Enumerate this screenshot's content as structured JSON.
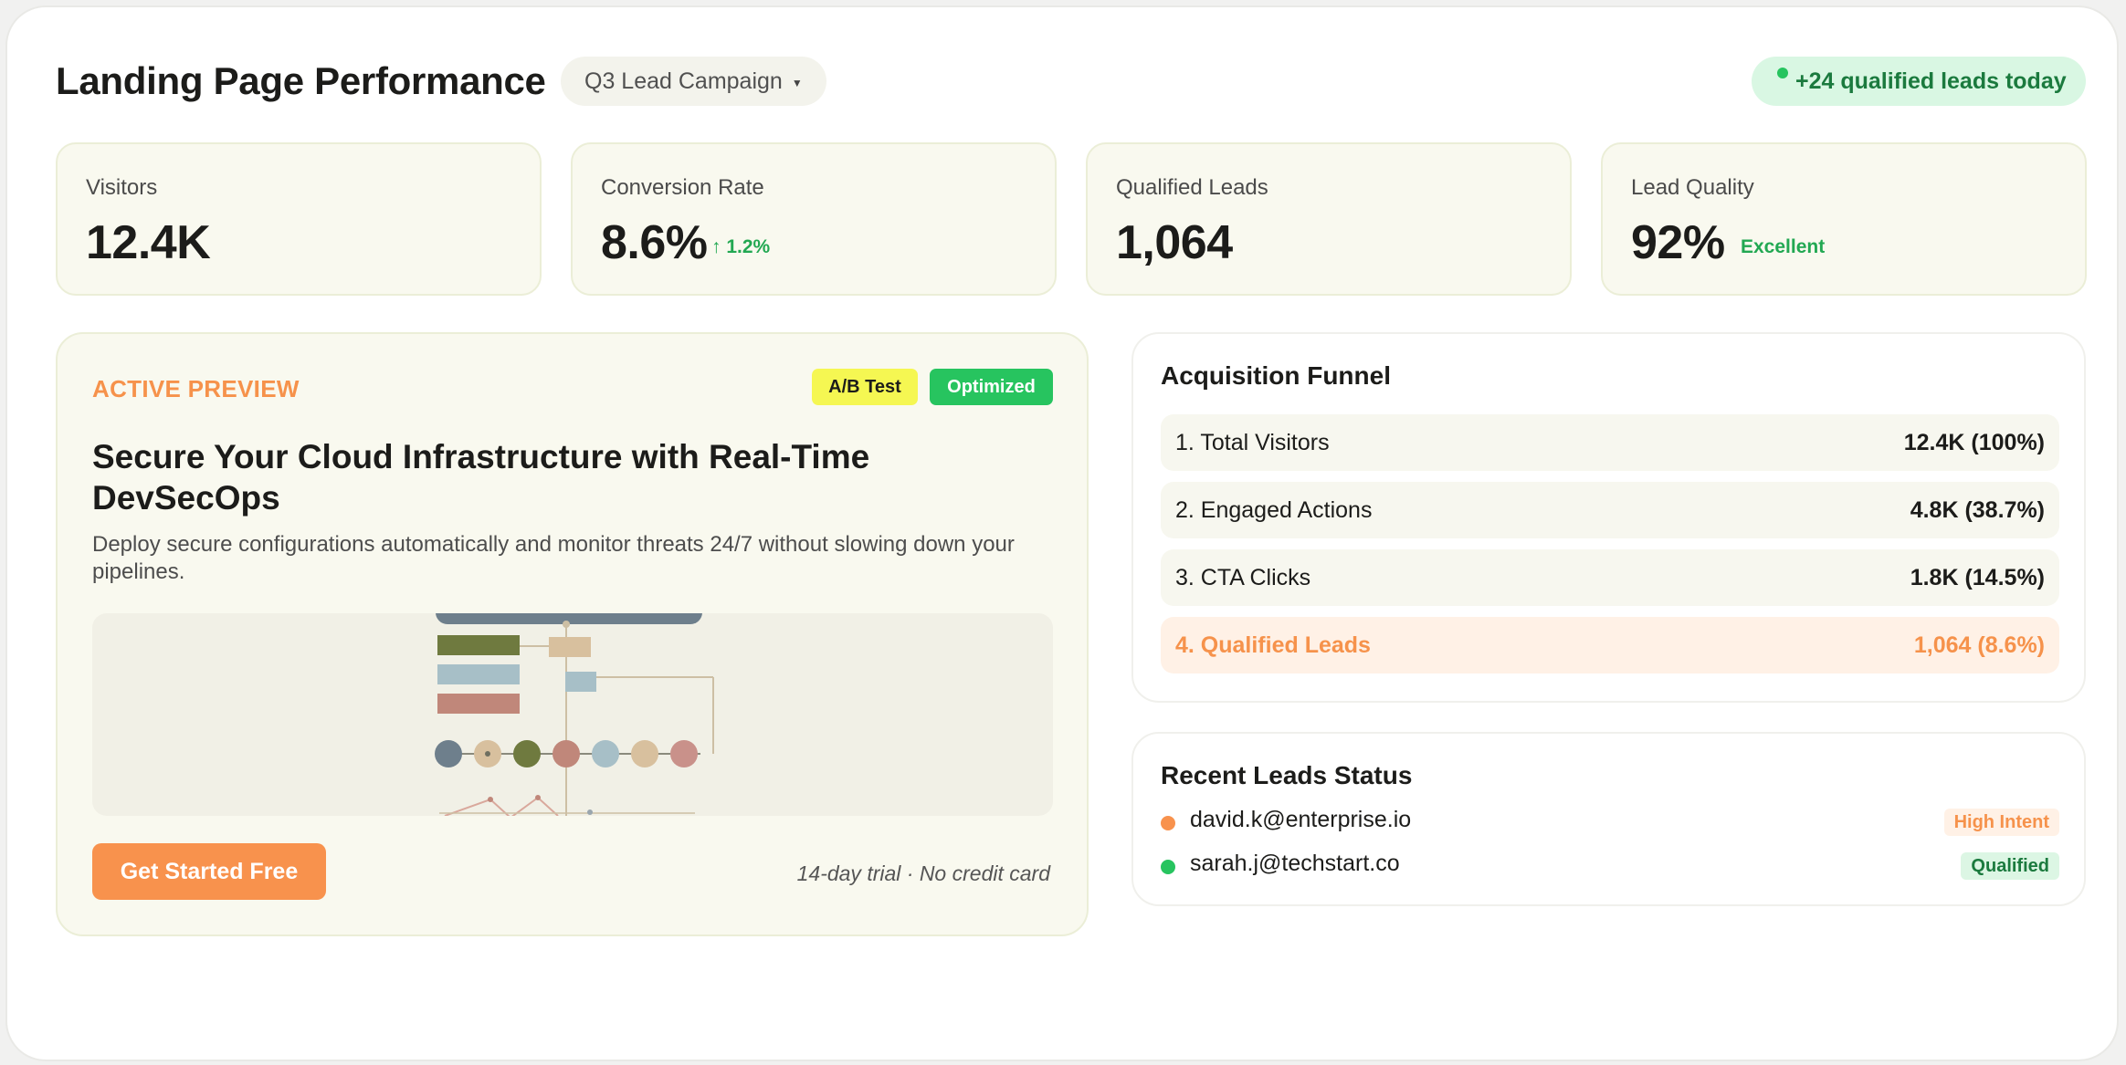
{
  "header": {
    "title": "Landing Page Performance",
    "campaign_select": "Q3 Lead Campaign",
    "leads_today": "+24 qualified leads today"
  },
  "kpis": [
    {
      "label": "Visitors",
      "value": "12.4K",
      "delta": ""
    },
    {
      "label": "Conversion Rate",
      "value": "8.6%",
      "delta": "↑ 1.2%"
    },
    {
      "label": "Qualified Leads",
      "value": "1,064",
      "delta": ""
    },
    {
      "label": "Lead Quality",
      "value": "92%",
      "delta": "Excellent"
    }
  ],
  "preview": {
    "eyebrow": "ACTIVE PREVIEW",
    "tags": [
      "A/B Test",
      "Optimized"
    ],
    "headline": "Secure Your Cloud Infrastructure with Real-Time DevSecOps",
    "subtext": "Deploy secure configurations automatically and monitor threats 24/7 without slowing down your pipelines.",
    "cta_label": "Get Started Free",
    "trial_note": "14-day trial · No credit card"
  },
  "funnel": {
    "title": "Acquisition Funnel",
    "rows": [
      {
        "label": "1. Total Visitors",
        "value": "12.4K (100%)"
      },
      {
        "label": "2. Engaged Actions",
        "value": "4.8K (38.7%)"
      },
      {
        "label": "3. CTA Clicks",
        "value": "1.8K (14.5%)"
      },
      {
        "label": "4. Qualified Leads",
        "value": "1,064 (8.6%)"
      }
    ]
  },
  "recent_leads": {
    "title": "Recent Leads Status",
    "items": [
      {
        "email": "david.k@enterprise.io",
        "status": "High Intent",
        "dot_color": "#f8924d"
      },
      {
        "email": "sarah.j@techstart.co",
        "status": "Qualified",
        "dot_color": "#27c45f"
      }
    ]
  },
  "colors": {
    "accent_orange": "#f8924d",
    "success_green": "#27c45f",
    "card_cream": "#f9f9ef",
    "ab_yellow": "#f5f752"
  },
  "icons": {
    "campaign_caret": "chevron-down-icon",
    "live_indicator": "status-dot-icon",
    "delta_arrow": "arrow-up-icon"
  }
}
